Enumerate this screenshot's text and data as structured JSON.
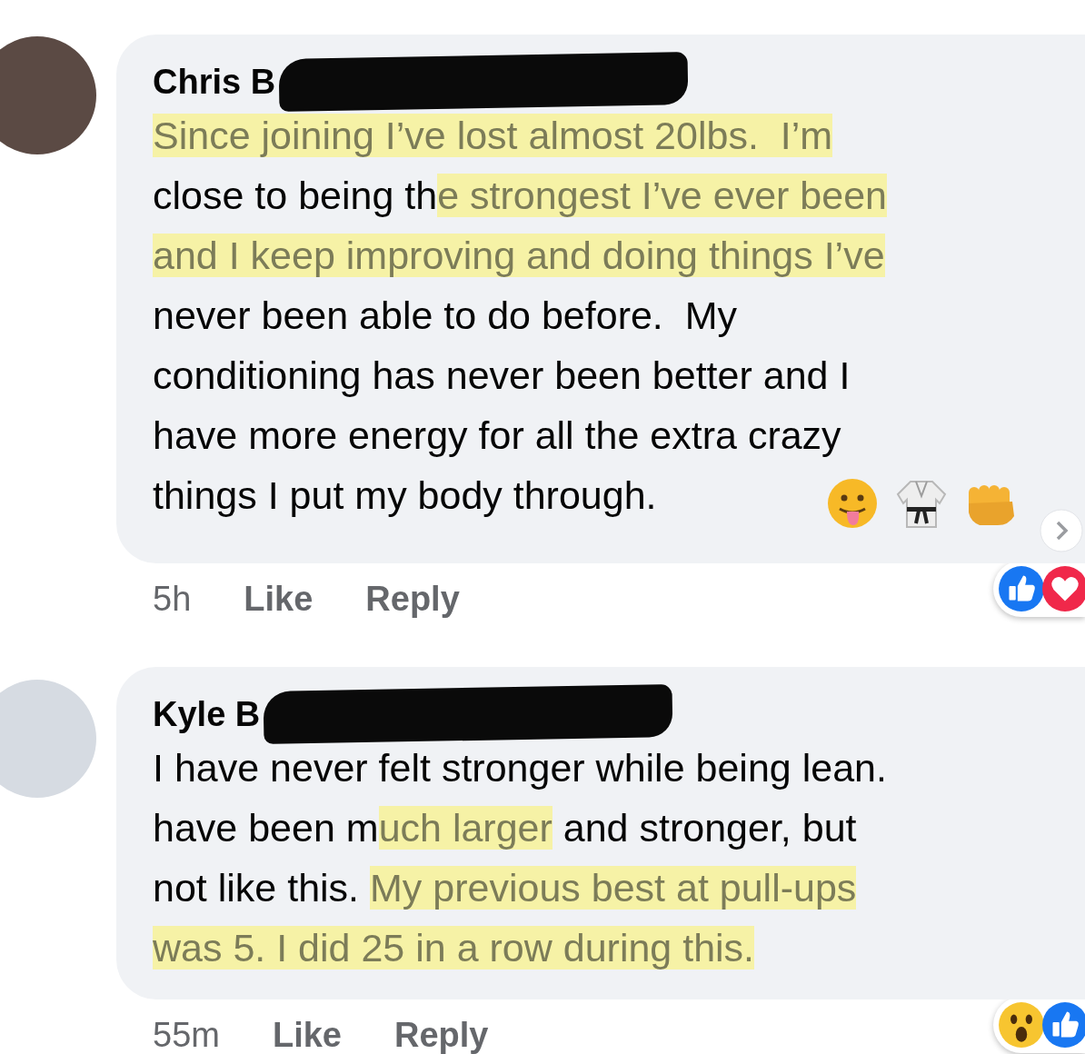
{
  "comments": [
    {
      "author": "Chris B",
      "redacted": true,
      "lines": [
        [
          {
            "text": "Since joining I’ve lost almost 20lbs.  I’m",
            "highlighted": true
          }
        ],
        [
          {
            "text": "close to being th",
            "highlighted": false
          },
          {
            "text": "e strongest I’ve ever been",
            "highlighted": true
          }
        ],
        [
          {
            "text": "and I keep improving and doing things I’ve",
            "highlighted": true
          }
        ],
        [
          {
            "text": "never been able to do before.  My",
            "highlighted": false
          }
        ],
        [
          {
            "text": "conditioning has never been better and I",
            "highlighted": false
          }
        ],
        [
          {
            "text": "have more energy for all the extra crazy",
            "highlighted": false
          }
        ],
        [
          {
            "text": "things I put my body through.",
            "highlighted": false
          }
        ]
      ],
      "emoji": [
        {
          "kind": "tongue"
        },
        {
          "kind": "uniform"
        },
        {
          "kind": "fist"
        }
      ],
      "more_arrow": true,
      "time": "5h",
      "actions": [
        "Like",
        "Reply"
      ],
      "reactions": [
        {
          "kind": "like"
        },
        {
          "kind": "love"
        }
      ]
    },
    {
      "author": "Kyle B",
      "redacted": true,
      "lines": [
        [
          {
            "text": "I have never felt stronger while being lean.",
            "highlighted": false
          }
        ],
        [
          {
            "text": "have been m",
            "highlighted": false
          },
          {
            "text": "uch larger",
            "highlighted": true
          },
          {
            "text": " and stronger, but",
            "highlighted": false
          }
        ],
        [
          {
            "text": "not like this. ",
            "highlighted": false
          },
          {
            "text": "My previous best at pull-ups",
            "highlighted": true
          }
        ],
        [
          {
            "text": "was 5. I did 25 in a row during this.",
            "highlighted": true
          }
        ]
      ],
      "time": "55m",
      "actions": [
        "Like",
        "Reply"
      ],
      "reactions": [
        {
          "kind": "wow"
        },
        {
          "kind": "like"
        }
      ]
    }
  ]
}
